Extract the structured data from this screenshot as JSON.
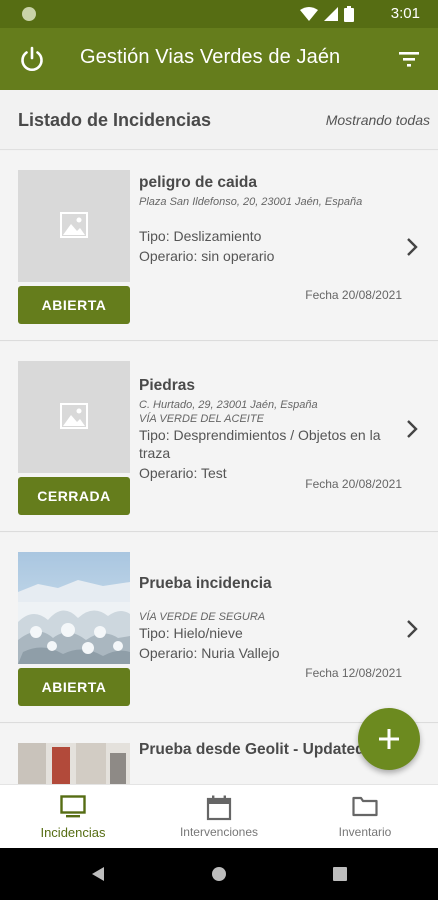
{
  "status_bar": {
    "time": "3:01"
  },
  "app_bar": {
    "title": "Gestión Vias Verdes de Jaén",
    "power_icon": "power-icon",
    "filter_icon": "filter-icon"
  },
  "list_header": {
    "title": "Listado de Incidencias",
    "showing": "Mostrando todas"
  },
  "incidents": [
    {
      "name": "peligro de caida",
      "address": "Plaza San Ildefonso, 20, 23001 Jaén, España",
      "via": "",
      "type": "Tipo: Deslizamiento",
      "operator": "Operario: sin operario",
      "date": "Fecha 20/08/2021",
      "status": "ABIERTA",
      "image": "placeholder"
    },
    {
      "name": "Piedras",
      "address": "C. Hurtado, 29, 23001 Jaén, España",
      "via": "VÍA VERDE DEL ACEITE",
      "type": "Tipo: Desprendimientos / Objetos en la traza",
      "operator": "Operario: Test",
      "date": "Fecha 20/08/2021",
      "status": "CERRADA",
      "image": "placeholder"
    },
    {
      "name": "Prueba incidencia",
      "address": "",
      "via": "VÍA VERDE DE SEGURA",
      "type": "Tipo: Hielo/nieve",
      "operator": "Operario: Nuria Vallejo",
      "date": "Fecha 12/08/2021",
      "status": "ABIERTA",
      "image": "snow-photo"
    },
    {
      "name": "Prueba desde Geolit - Updated",
      "address": "",
      "via": "",
      "type": "",
      "operator": "",
      "date": "",
      "status": "",
      "image": "interior-photo"
    }
  ],
  "fab": {
    "icon": "plus-icon"
  },
  "bottom_nav": [
    {
      "label": "Incidencias",
      "icon": "monitor-icon",
      "active": true
    },
    {
      "label": "Intervenciones",
      "icon": "calendar-icon",
      "active": false
    },
    {
      "label": "Inventario",
      "icon": "folder-icon",
      "active": false
    }
  ],
  "colors": {
    "primary": "#657d1c",
    "status_bar": "#566d13",
    "fab": "#6c8a1f"
  }
}
